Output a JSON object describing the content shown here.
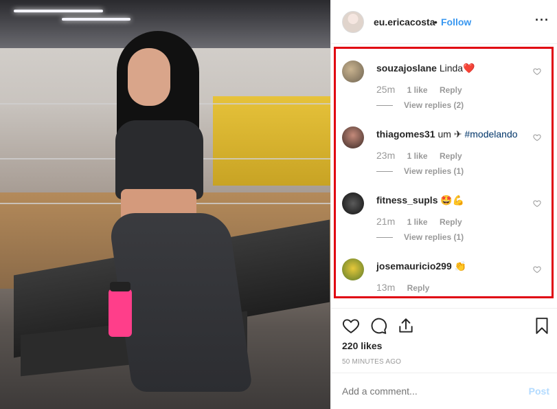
{
  "post": {
    "photo_alt": "gym photo",
    "author": "eu.ericacosta",
    "separator": "•",
    "follow_label": "Follow",
    "more_icon": "more-horizontal-icon",
    "more_label": "···"
  },
  "comments": [
    {
      "username": "souzajoslane",
      "text": "Linda",
      "emoji": "❤️",
      "time": "25m",
      "likes": "1 like",
      "reply": "Reply",
      "view_replies": "View replies (2)"
    },
    {
      "username": "thiagomes31",
      "text": "um ✈ ",
      "hashtag": "#modelando",
      "time": "23m",
      "likes": "1 like",
      "reply": "Reply",
      "view_replies": "View replies (1)"
    },
    {
      "username": "fitness_supls",
      "text": "",
      "emoji": "🤩💪",
      "time": "21m",
      "likes": "1 like",
      "reply": "Reply",
      "view_replies": "View replies (1)"
    },
    {
      "username": "josemauricio299",
      "text": "",
      "emoji": "👏",
      "time": "13m",
      "reply": "Reply"
    }
  ],
  "actions": {
    "likes_count": "220 likes",
    "time_ago": "50 MINUTES AGO"
  },
  "add_comment": {
    "placeholder": "Add a comment...",
    "post_label": "Post"
  },
  "colors": {
    "follow_blue": "#3897f0",
    "highlight_red": "#e00010",
    "meta_gray": "#999999",
    "post_disabled": "#b3dbff"
  }
}
